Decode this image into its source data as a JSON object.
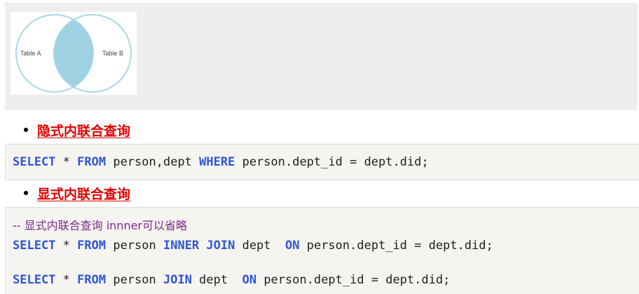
{
  "venn": {
    "left_label": "Table A",
    "right_label": "Table B",
    "circle_stroke": "#a8d8e6",
    "overlap_fill": "#9ed2e2"
  },
  "sections": [
    {
      "heading": "隐式内联合查询"
    },
    {
      "heading": "显式内联合查询"
    }
  ],
  "code1": {
    "line1": {
      "t1": "SELECT",
      "t2": " * ",
      "t3": "FROM",
      "t4": " person,dept ",
      "t5": "WHERE",
      "t6": " person.dept_id = dept.did;"
    }
  },
  "code2": {
    "comment": "-- 显式内联合查询 innner可以省略",
    "line1": {
      "t1": "SELECT",
      "t2": " * ",
      "t3": "FROM",
      "t4": " person ",
      "t5": "INNER JOIN",
      "t6": " dept  ",
      "t7": "ON",
      "t8": " person.dept_id = dept.did;"
    },
    "line2": {
      "t1": "SELECT",
      "t2": " * ",
      "t3": "FROM",
      "t4": " person ",
      "t5": "JOIN",
      "t6": " dept  ",
      "t7": "ON",
      "t8": " person.dept_id = dept.did;"
    }
  },
  "colors": {
    "keyword": "#2f56d6",
    "heading_link": "#e00000",
    "comment": "#7a2a8a"
  }
}
